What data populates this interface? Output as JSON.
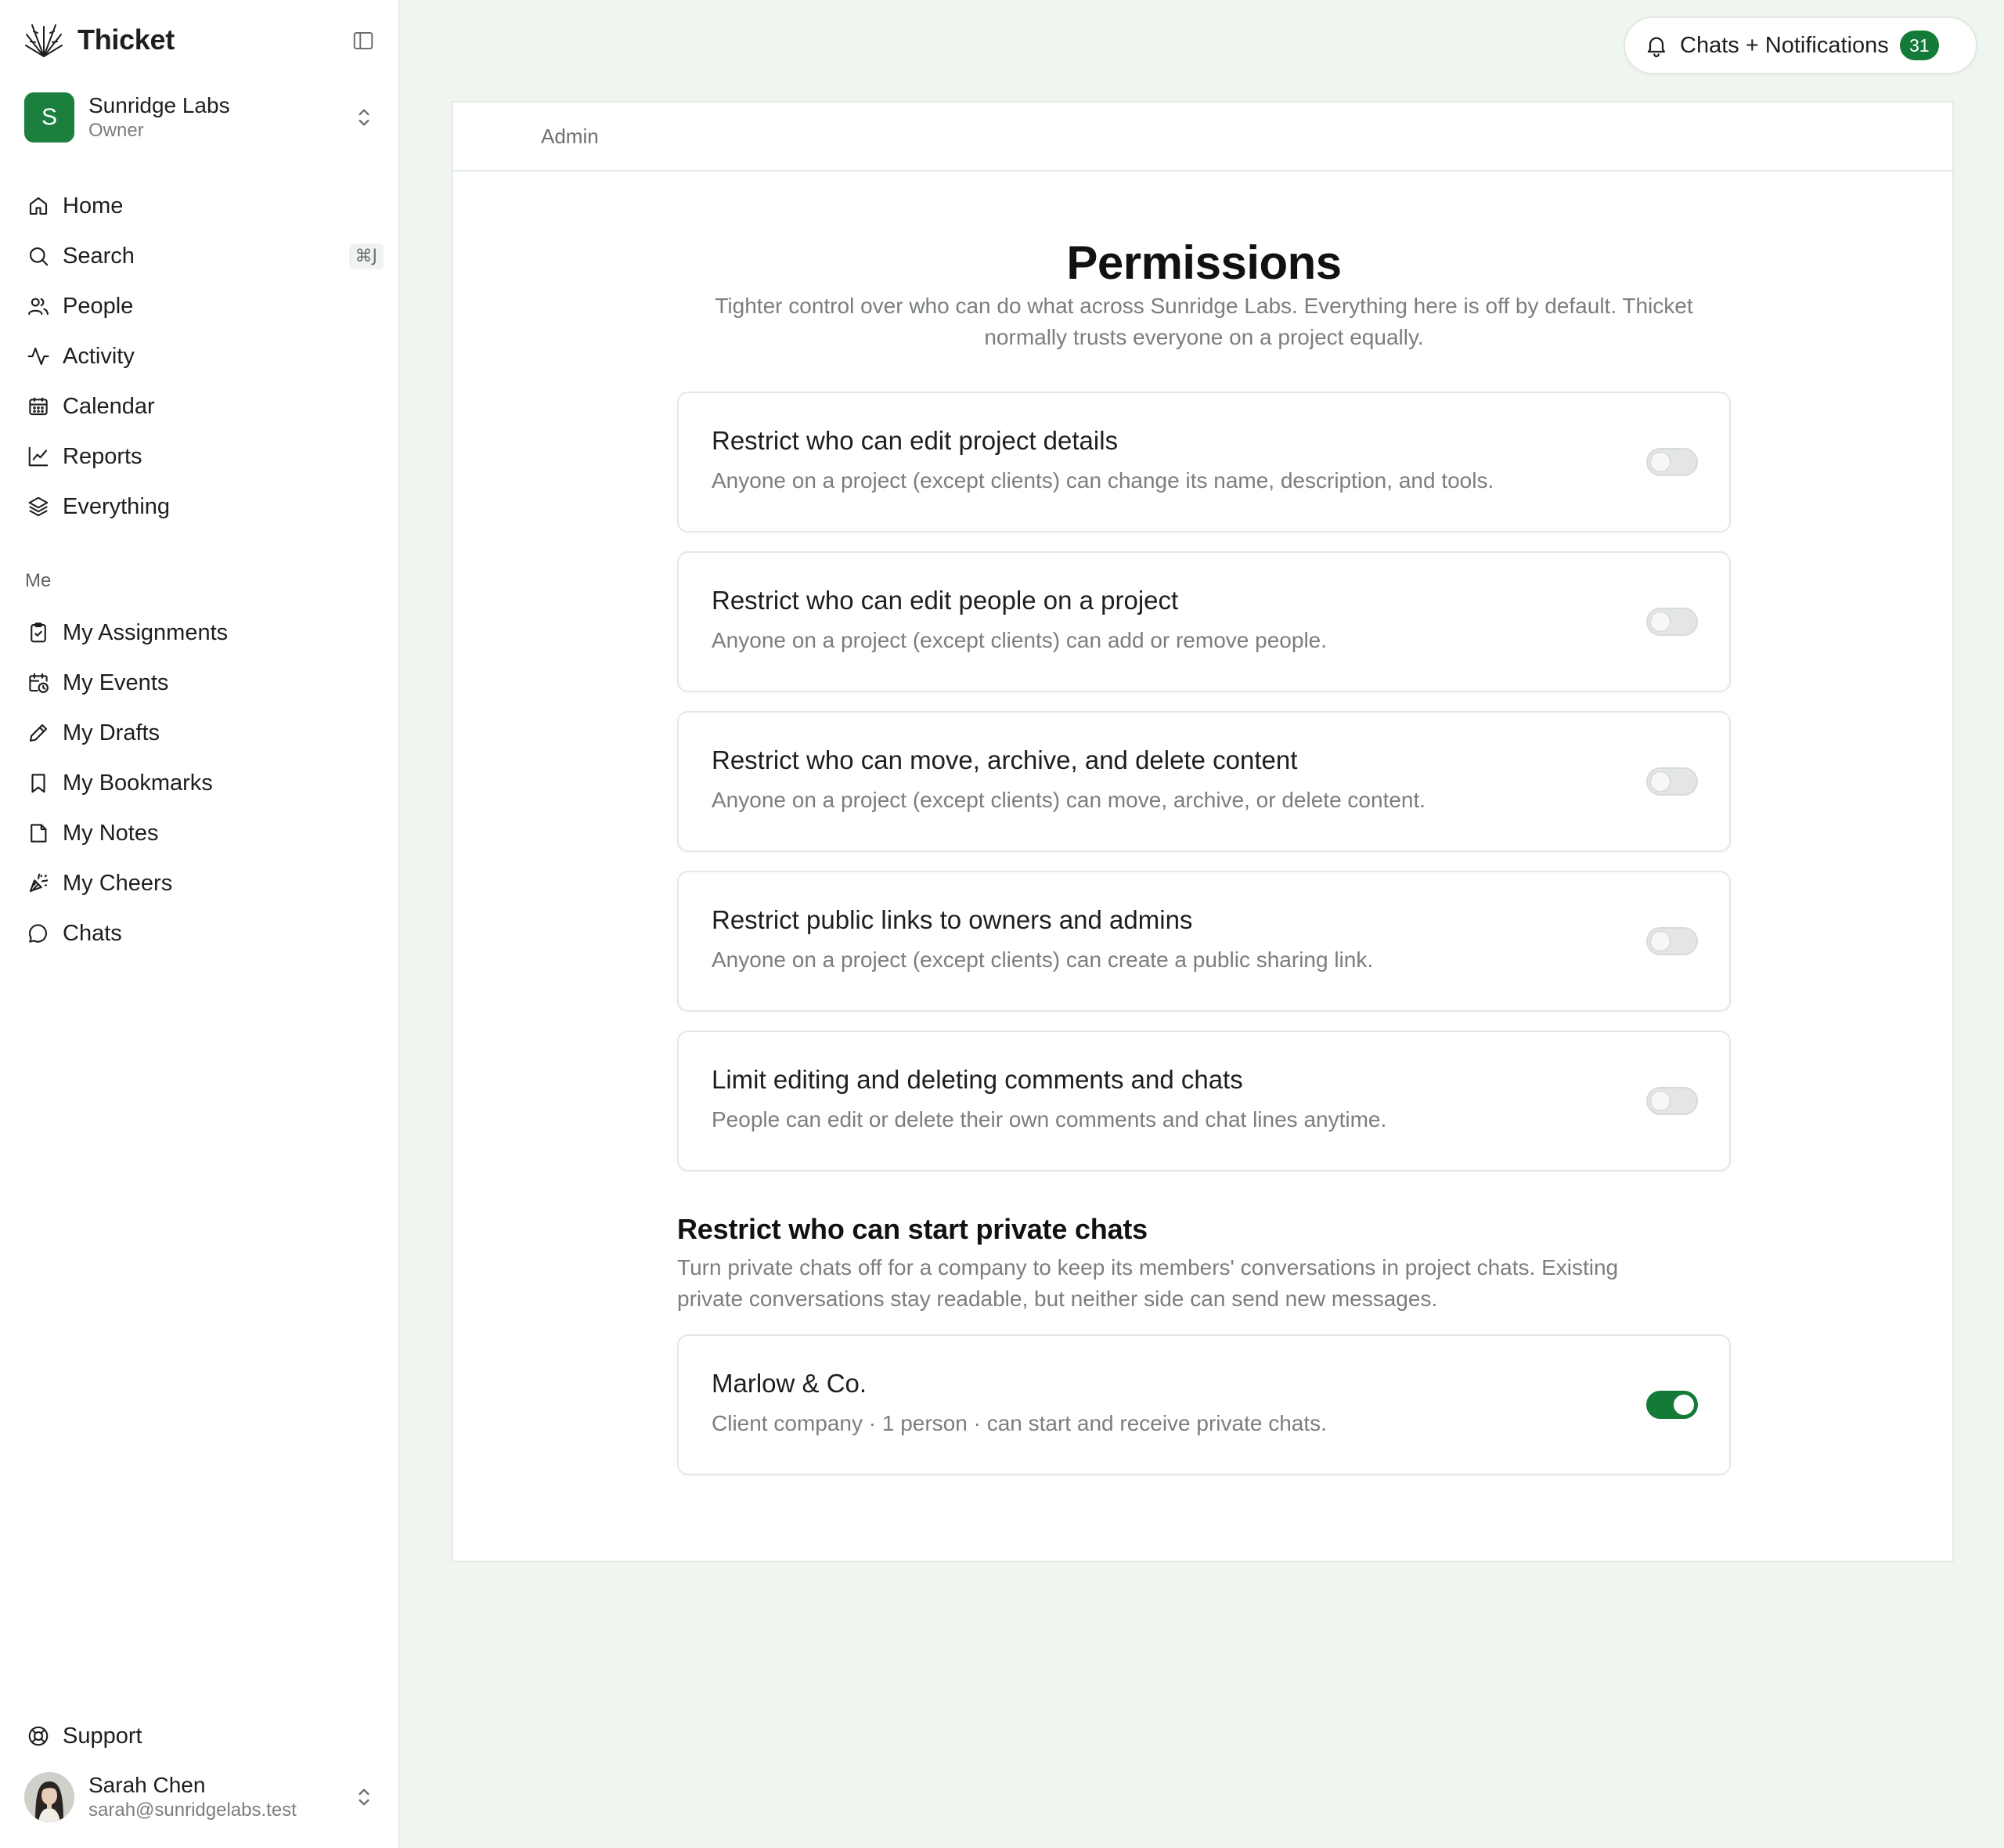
{
  "app": {
    "name": "Thicket"
  },
  "workspace": {
    "initial": "S",
    "name": "Sunridge Labs",
    "role": "Owner"
  },
  "nav": {
    "main": [
      {
        "label": "Home",
        "icon": "home-icon"
      },
      {
        "label": "Search",
        "icon": "search-icon",
        "shortcut": "⌘J"
      },
      {
        "label": "People",
        "icon": "people-icon"
      },
      {
        "label": "Activity",
        "icon": "activity-icon"
      },
      {
        "label": "Calendar",
        "icon": "calendar-icon"
      },
      {
        "label": "Reports",
        "icon": "chart-icon"
      },
      {
        "label": "Everything",
        "icon": "layers-icon"
      }
    ],
    "me_label": "Me",
    "me": [
      {
        "label": "My Assignments",
        "icon": "clipboard-check-icon"
      },
      {
        "label": "My Events",
        "icon": "calendar-clock-icon"
      },
      {
        "label": "My Drafts",
        "icon": "pencil-icon"
      },
      {
        "label": "My Bookmarks",
        "icon": "bookmark-icon"
      },
      {
        "label": "My Notes",
        "icon": "note-icon"
      },
      {
        "label": "My Cheers",
        "icon": "party-popper-icon"
      },
      {
        "label": "Chats",
        "icon": "chat-bubble-icon"
      }
    ],
    "support": "Support"
  },
  "user": {
    "name": "Sarah Chen",
    "email": "sarah@sunridgelabs.test"
  },
  "notifications": {
    "label": "Chats + Notifications",
    "count": "31"
  },
  "breadcrumb": "Admin",
  "page": {
    "title": "Permissions",
    "subtitle_line1": "Tighter control over who can do what across Sunridge Labs. Everything here is off by default. Thicket",
    "subtitle_line2": "normally trusts everyone on a project equally."
  },
  "permissions": [
    {
      "title": "Restrict who can edit project details",
      "description": "Anyone on a project (except clients) can change its name, description, and tools.",
      "enabled": false
    },
    {
      "title": "Restrict who can edit people on a project",
      "description": "Anyone on a project (except clients) can add or remove people.",
      "enabled": false
    },
    {
      "title": "Restrict who can move, archive, and delete content",
      "description": "Anyone on a project (except clients) can move, archive, or delete content.",
      "enabled": false
    },
    {
      "title": "Restrict public links to owners and admins",
      "description": "Anyone on a project (except clients) can create a public sharing link.",
      "enabled": false
    },
    {
      "title": "Limit editing and deleting comments and chats",
      "description": "People can edit or delete their own comments and chat lines anytime.",
      "enabled": false
    }
  ],
  "private_chats": {
    "heading": "Restrict who can start private chats",
    "description_line1": "Turn private chats off for a company to keep its members' conversations in project chats. Existing",
    "description_line2": "private conversations stay readable, but neither side can send new messages.",
    "companies": [
      {
        "name": "Marlow & Co.",
        "description": "Client company · 1 person · can start and receive private chats.",
        "enabled": true
      }
    ]
  },
  "colors": {
    "accent": "#137a37",
    "background": "#eff6ef"
  }
}
